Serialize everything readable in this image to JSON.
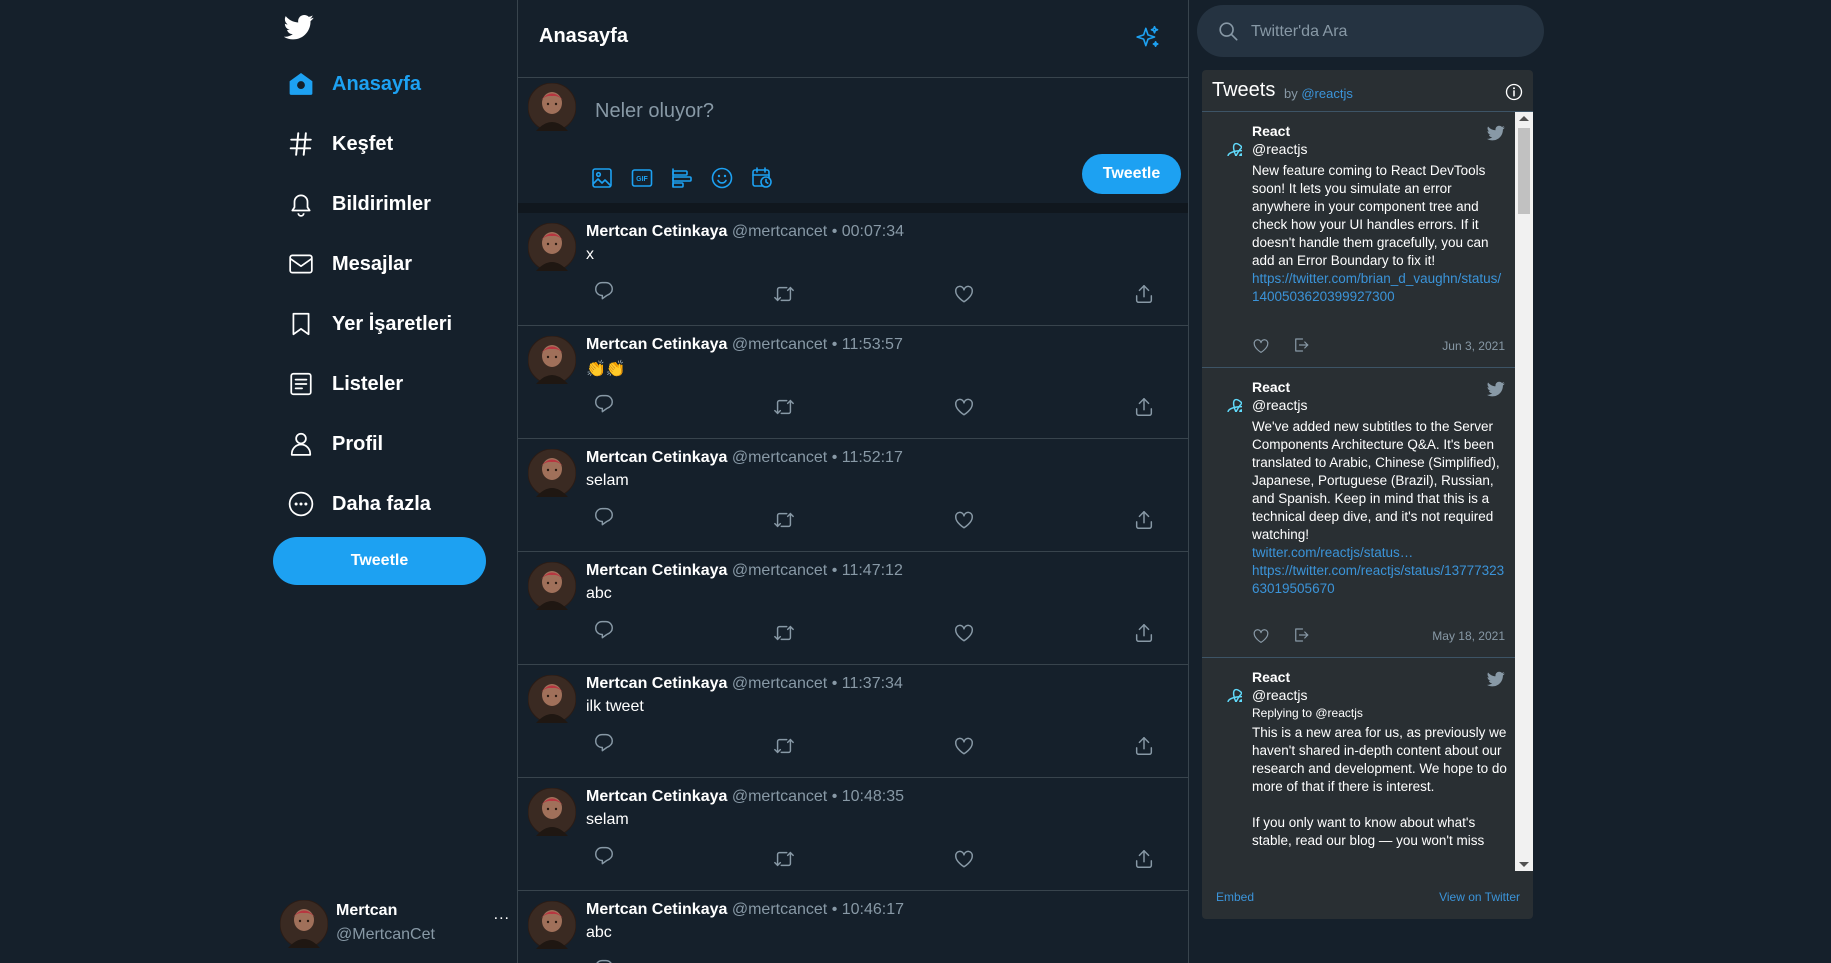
{
  "nav": {
    "items": [
      {
        "label": "Anasayfa",
        "icon": "home-icon",
        "active": true
      },
      {
        "label": "Keşfet",
        "icon": "hashtag-icon"
      },
      {
        "label": "Bildirimler",
        "icon": "bell-icon"
      },
      {
        "label": "Mesajlar",
        "icon": "envelope-icon"
      },
      {
        "label": "Yer İşaretleri",
        "icon": "bookmark-icon"
      },
      {
        "label": "Listeler",
        "icon": "list-icon"
      },
      {
        "label": "Profil",
        "icon": "user-icon"
      },
      {
        "label": "Daha fazla",
        "icon": "more-circle-icon"
      }
    ],
    "tweet_button": "Tweetle"
  },
  "account": {
    "name": "Mertcan",
    "handle": "@MertcanCet",
    "more": "..."
  },
  "main": {
    "title": "Anasayfa",
    "composer": {
      "placeholder": "Neler oluyor?",
      "tweet_button": "Tweetle"
    }
  },
  "tweets": [
    {
      "name": "Mertcan Cetinkaya",
      "handle": "@mertcancet",
      "sep": "•",
      "time": "00:07:34",
      "text": "x"
    },
    {
      "name": "Mertcan Cetinkaya",
      "handle": "@mertcancet",
      "sep": "•",
      "time": "11:53:57",
      "text": "👏👏"
    },
    {
      "name": "Mertcan Cetinkaya",
      "handle": "@mertcancet",
      "sep": "•",
      "time": "11:52:17",
      "text": "selam"
    },
    {
      "name": "Mertcan Cetinkaya",
      "handle": "@mertcancet",
      "sep": "•",
      "time": "11:47:12",
      "text": "abc"
    },
    {
      "name": "Mertcan Cetinkaya",
      "handle": "@mertcancet",
      "sep": "•",
      "time": "11:37:34",
      "text": "ilk tweet"
    },
    {
      "name": "Mertcan Cetinkaya",
      "handle": "@mertcancet",
      "sep": "•",
      "time": "10:48:35",
      "text": "selam"
    },
    {
      "name": "Mertcan Cetinkaya",
      "handle": "@mertcancet",
      "sep": "•",
      "time": "10:46:17",
      "text": "abc"
    }
  ],
  "search": {
    "placeholder": "Twitter'da Ara"
  },
  "widget": {
    "title": "Tweets",
    "by": "by",
    "by_handle": "@reactjs",
    "embed": "Embed",
    "view": "View on Twitter",
    "tweets": [
      {
        "name": "React",
        "handle": "@reactjs",
        "body": "New feature coming to React DevTools soon! It lets you simulate an error anywhere in your component tree and check how your UI handles errors. If it doesn't handle them gracefully, you can add an Error Boundary to fix it!",
        "link": "https://twitter.com/brian_d_vaughn/status/1400503620399927300",
        "date": "Jun 3, 2021"
      },
      {
        "name": "React",
        "handle": "@reactjs",
        "body": "We've added new subtitles to the Server Components Architecture Q&A. It's been translated to Arabic, Chinese (Simplified), Japanese, Portuguese (Brazil), Russian, and Spanish. Keep in mind that this is a technical deep dive, and it's not required watching!",
        "link1": "twitter.com/reactjs/status…",
        "link2": "https://twitter.com/reactjs/status/1377732363019505670",
        "date": "May 18, 2021"
      },
      {
        "name": "React",
        "handle": "@reactjs",
        "reply": "Replying to @reactjs",
        "body": "This is a new area for us, as previously we haven't shared in-depth content about our research and development. We hope to do more of that if there is interest.",
        "body2": "If you only want to know about what's stable, read our blog — you won't miss"
      }
    ]
  },
  "colors": {
    "background": "#15202b",
    "accent": "#1da1f2",
    "muted": "#8899a6",
    "border": "#38444d",
    "widget_bg": "#292f33",
    "link": "#3b94d9"
  }
}
